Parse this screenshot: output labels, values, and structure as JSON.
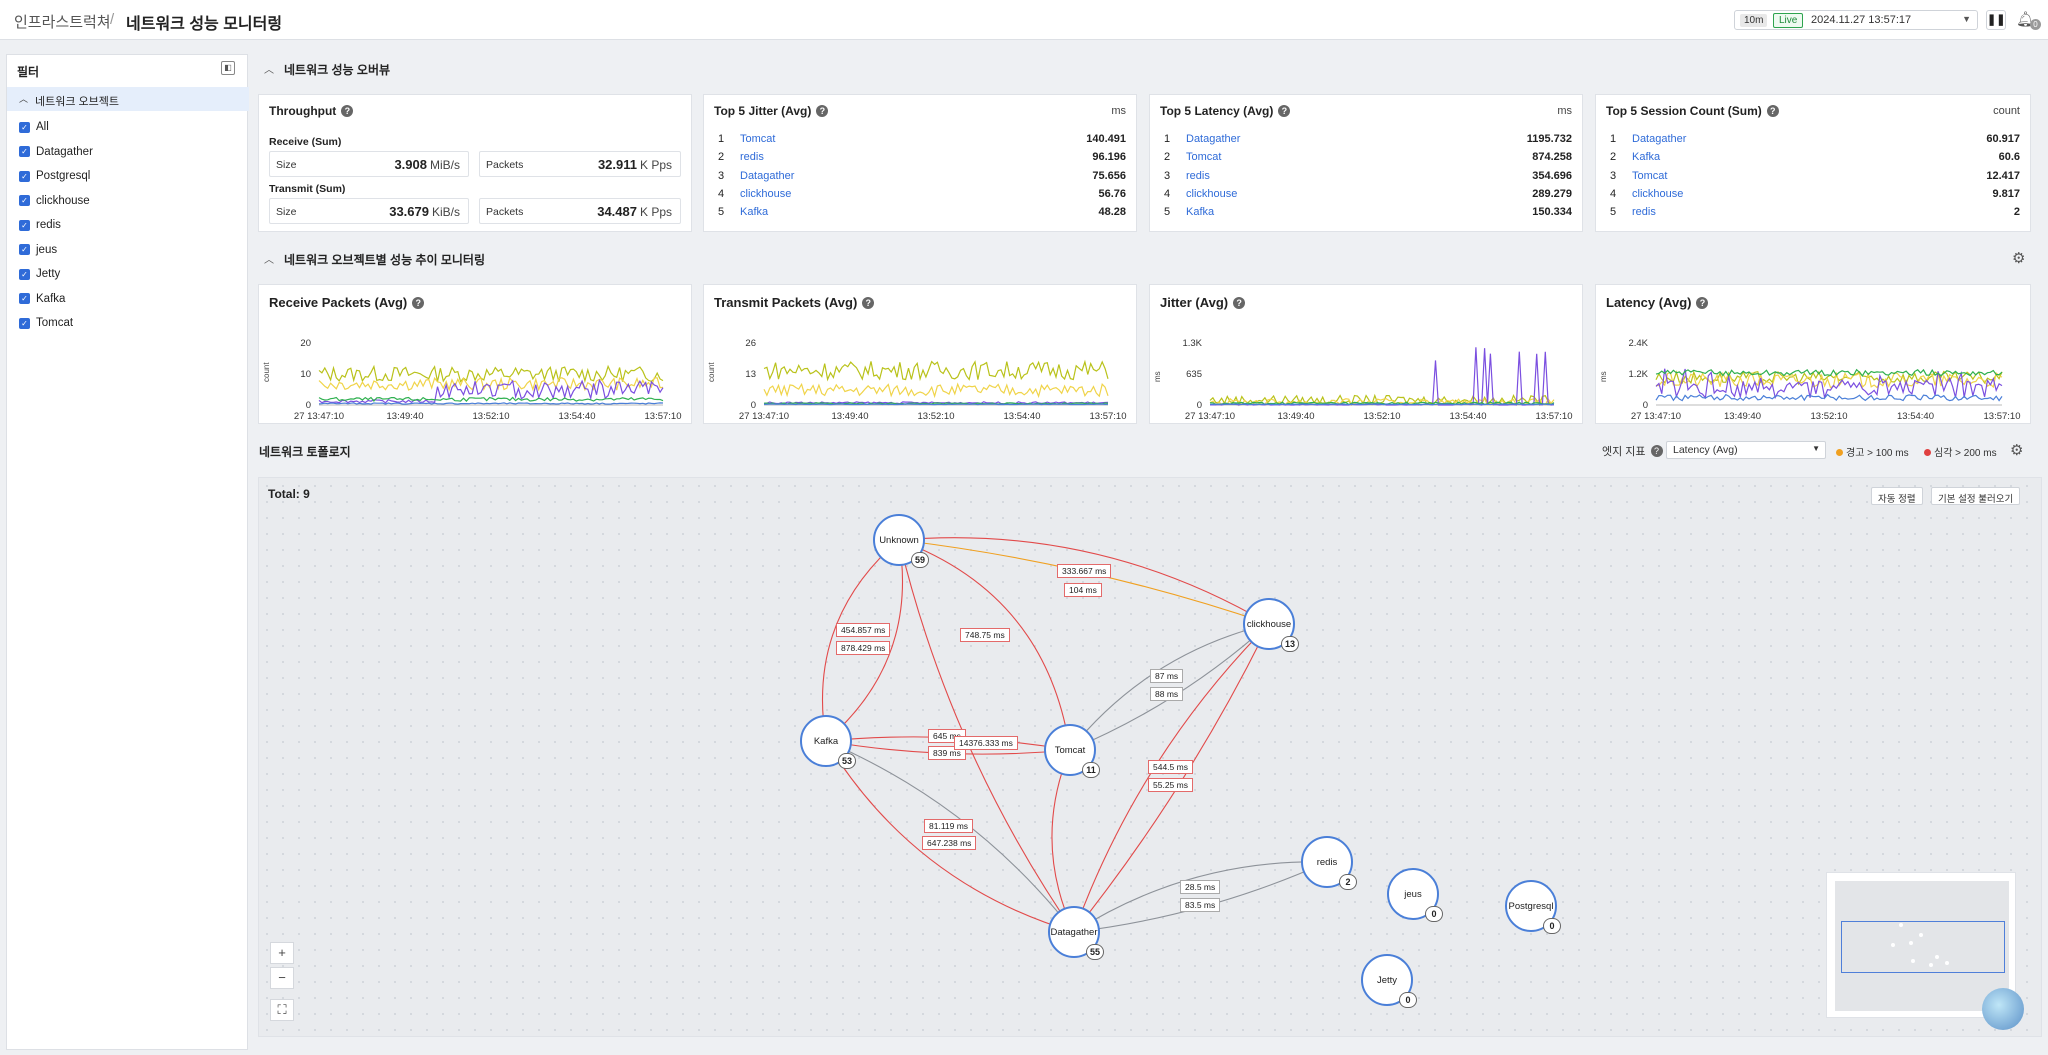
{
  "header": {
    "breadcrumb_root": "인프라스트럭쳐",
    "breadcrumb_sep": "/",
    "page_title": "네트워크 성능 모니터링",
    "range": "10m",
    "live": "Live",
    "time": "2024.11.27 13:57:17",
    "notifications": "0"
  },
  "sidebar": {
    "title": "필터",
    "group": "네트워크 오브젝트",
    "items": [
      {
        "label": "All"
      },
      {
        "label": "Datagather"
      },
      {
        "label": "Postgresql"
      },
      {
        "label": "clickhouse"
      },
      {
        "label": "redis"
      },
      {
        "label": "jeus"
      },
      {
        "label": "Jetty"
      },
      {
        "label": "Kafka"
      },
      {
        "label": "Tomcat"
      }
    ]
  },
  "overview": {
    "title": "네트워크 성능 오버뷰",
    "throughput": {
      "title": "Throughput",
      "receive_title": "Receive (Sum)",
      "transmit_title": "Transmit (Sum)",
      "size_label": "Size",
      "packets_label": "Packets",
      "receive_size": "3.908",
      "receive_size_unit": "MiB/s",
      "receive_packets": "32.911",
      "receive_packets_unit": "K Pps",
      "transmit_size": "33.679",
      "transmit_size_unit": "KiB/s",
      "transmit_packets": "34.487",
      "transmit_packets_unit": "K Pps"
    },
    "jitter": {
      "title": "Top 5 Jitter (Avg)",
      "unit": "ms",
      "rows": [
        {
          "rank": "1",
          "name": "Tomcat",
          "value": "140.491"
        },
        {
          "rank": "2",
          "name": "redis",
          "value": "96.196"
        },
        {
          "rank": "3",
          "name": "Datagather",
          "value": "75.656"
        },
        {
          "rank": "4",
          "name": "clickhouse",
          "value": "56.76"
        },
        {
          "rank": "5",
          "name": "Kafka",
          "value": "48.28"
        }
      ]
    },
    "latency": {
      "title": "Top 5 Latency (Avg)",
      "unit": "ms",
      "rows": [
        {
          "rank": "1",
          "name": "Datagather",
          "value": "1195.732"
        },
        {
          "rank": "2",
          "name": "Tomcat",
          "value": "874.258"
        },
        {
          "rank": "3",
          "name": "redis",
          "value": "354.696"
        },
        {
          "rank": "4",
          "name": "clickhouse",
          "value": "289.279"
        },
        {
          "rank": "5",
          "name": "Kafka",
          "value": "150.334"
        }
      ]
    },
    "session": {
      "title": "Top 5 Session Count (Sum)",
      "unit": "count",
      "rows": [
        {
          "rank": "1",
          "name": "Datagather",
          "value": "60.917"
        },
        {
          "rank": "2",
          "name": "Kafka",
          "value": "60.6"
        },
        {
          "rank": "3",
          "name": "Tomcat",
          "value": "12.417"
        },
        {
          "rank": "4",
          "name": "clickhouse",
          "value": "9.817"
        },
        {
          "rank": "5",
          "name": "redis",
          "value": "2"
        }
      ]
    }
  },
  "trend": {
    "title": "네트워크 오브젝트별 성능 추이 모니터링"
  },
  "chart_data": [
    {
      "type": "line",
      "title": "Receive Packets (Avg)",
      "ylabel": "count",
      "ylim": [
        0,
        20
      ],
      "yticks": [
        "20",
        "10",
        "0"
      ],
      "xticks": [
        "27 13:47:10",
        "13:49:40",
        "13:52:10",
        "13:54:40",
        "13:57:10"
      ]
    },
    {
      "type": "line",
      "title": "Transmit Packets (Avg)",
      "ylabel": "count",
      "ylim": [
        0,
        26
      ],
      "yticks": [
        "26",
        "13",
        "0"
      ],
      "xticks": [
        "27 13:47:10",
        "13:49:40",
        "13:52:10",
        "13:54:40",
        "13:57:10"
      ]
    },
    {
      "type": "line",
      "title": "Jitter (Avg)",
      "ylabel": "ms",
      "ylim": [
        0,
        1300
      ],
      "yticks": [
        "1.3K",
        "635",
        "0"
      ],
      "xticks": [
        "27 13:47:10",
        "13:49:40",
        "13:52:10",
        "13:54:40",
        "13:57:10"
      ]
    },
    {
      "type": "line",
      "title": "Latency (Avg)",
      "ylabel": "ms",
      "ylim": [
        0,
        2400
      ],
      "yticks": [
        "2.4K",
        "1.2K",
        "0"
      ],
      "xticks": [
        "27 13:47:10",
        "13:49:40",
        "13:52:10",
        "13:54:40",
        "13:57:10"
      ]
    }
  ],
  "topology": {
    "title": "네트워크 토폴로지",
    "edge_metric_label": "엣지 지표",
    "edge_metric": "Latency (Avg)",
    "warn": "경고 > 100 ms",
    "crit": "심각 > 200 ms",
    "total": "Total: 9",
    "auto_align": "자동 정렬",
    "load_default": "기본 설정 불러오기",
    "zoom_in": "+",
    "zoom_out": "−",
    "fit": "⛶",
    "nodes": [
      {
        "name": "Unknown",
        "count": "59"
      },
      {
        "name": "clickhouse",
        "count": "13"
      },
      {
        "name": "Kafka",
        "count": "53"
      },
      {
        "name": "Tomcat",
        "count": "11"
      },
      {
        "name": "redis",
        "count": "2"
      },
      {
        "name": "jeus",
        "count": "0"
      },
      {
        "name": "Postgresql",
        "count": "0"
      },
      {
        "name": "Datagather",
        "count": "55"
      },
      {
        "name": "Jetty",
        "count": "0"
      }
    ],
    "edges": [
      "333.667 ms",
      "104 ms",
      "454.857 ms",
      "878.429 ms",
      "748.75 ms",
      "87 ms",
      "88 ms",
      "645 ms",
      "839 ms",
      "14376.333 ms",
      "544.5 ms",
      "55.25 ms",
      "81.119 ms",
      "647.238 ms",
      "28.5 ms",
      "83.5 ms"
    ]
  },
  "colors": {
    "accent": "#2f6bd8",
    "warn": "#f0a020",
    "crit": "#e04040"
  }
}
